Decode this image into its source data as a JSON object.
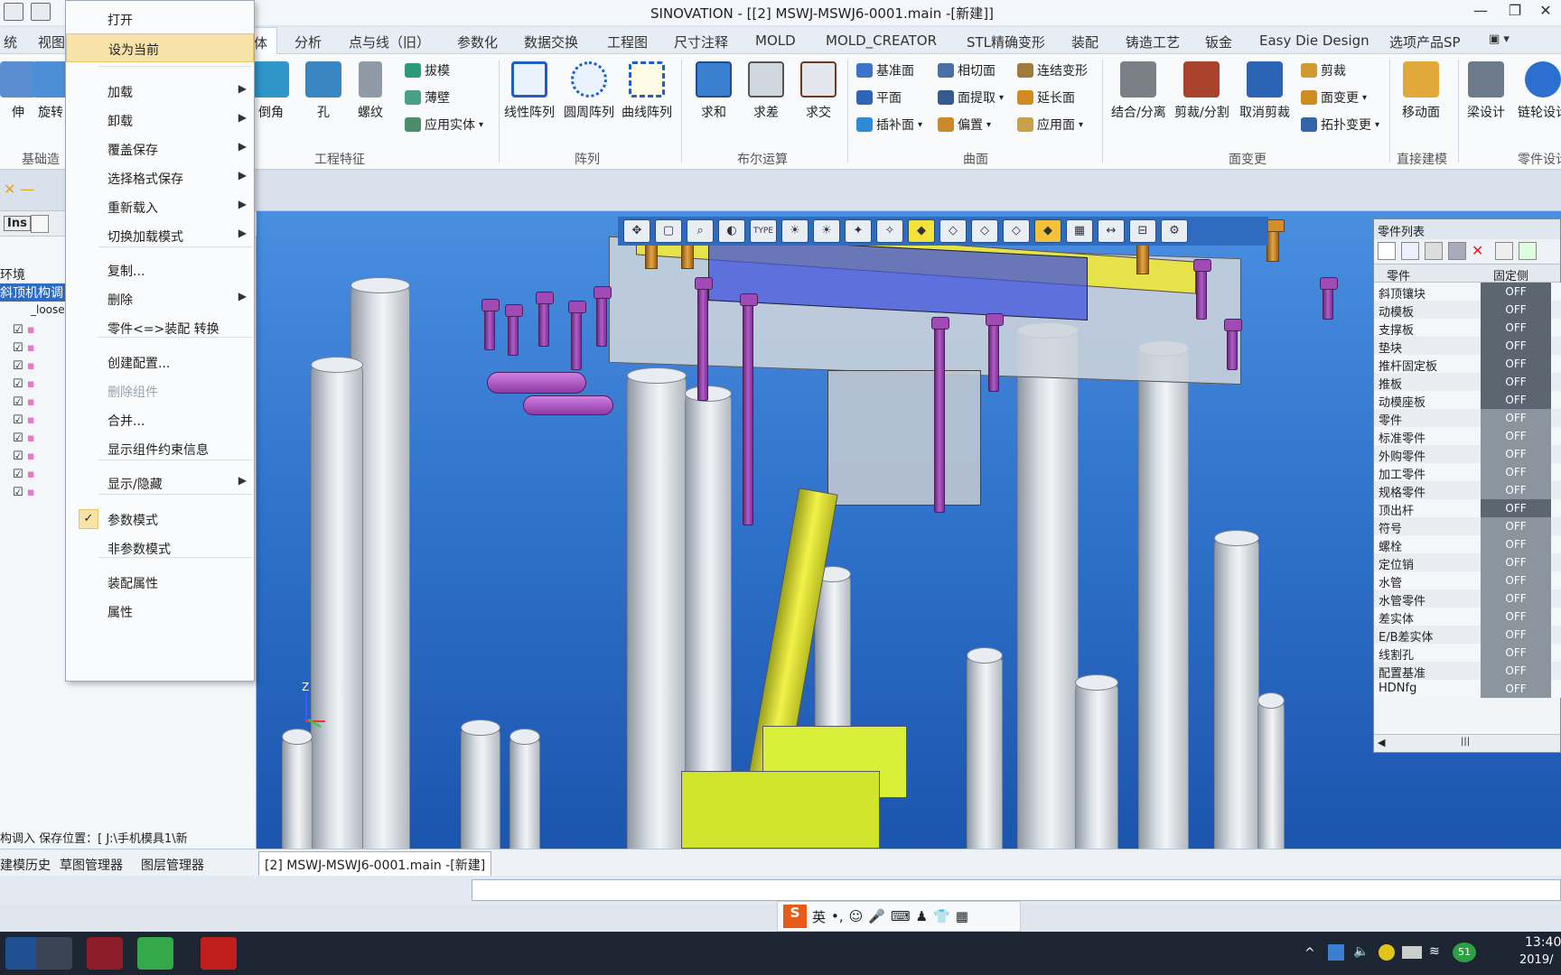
{
  "window": {
    "title": "SINOVATION - [[2] MSWJ-MSWJ6-0001.main -[新建]]",
    "minimize": "—",
    "maximize": "❐",
    "close": "✕"
  },
  "tabs": [
    "统",
    "视图",
    "体",
    "分析",
    "点与线（旧）",
    "参数化",
    "数据交换",
    "工程图",
    "尺寸注释",
    "MOLD",
    "MOLD_CREATOR",
    "STL精确变形",
    "装配",
    "铸造工艺",
    "钣金",
    "Easy Die Design",
    "选项产品SP"
  ],
  "active_tab": "体",
  "ribbon": {
    "partial_left": {
      "btn1": "伸",
      "btn2": "旋转",
      "group": "基础造"
    },
    "engineering": {
      "chamfer": "倒角",
      "hole": "孔",
      "thread": "螺纹",
      "draft": "拔模",
      "shell": "薄壁",
      "apply_solid": "应用实体",
      "group": "工程特征"
    },
    "array": {
      "linear": "线性阵列",
      "circular": "圆周阵列",
      "curve": "曲线阵列",
      "group": "阵列"
    },
    "boolean": {
      "union": "求和",
      "subtract": "求差",
      "intersect": "求交",
      "group": "布尔运算"
    },
    "surface": {
      "base_plane": "基准面",
      "plane": "平面",
      "patch": "插补面",
      "tangent": "相切面",
      "extract": "面提取",
      "offset": "偏置",
      "connect": "连结变形",
      "extend": "延长面",
      "apply_face": "应用面",
      "group": "曲面"
    },
    "face_change": {
      "combine": "结合/分离",
      "cut_split": "剪裁/分割",
      "uncut": "取消剪裁",
      "trim": "剪裁",
      "face_change": "面变更",
      "topo": "拓扑变更",
      "group": "面变更"
    },
    "direct": {
      "move_face": "移动面",
      "group": "直接建模"
    },
    "part_design": {
      "beam": "梁设计",
      "gear": "链轮设计",
      "group": "零件设计"
    }
  },
  "left_panel": {
    "header_ins": "Ins",
    "env_label": "环境",
    "selected_item": "斜顶机构调",
    "loose_item": "_loose",
    "status": "构调入  保存位置：[ J:\\手机模具1\\新",
    "bottom_tabs": [
      "建模历史",
      "草图管理器",
      "图层管理器"
    ]
  },
  "context_menu": {
    "items": [
      {
        "label": "打开",
        "arrow": false
      },
      {
        "label": "设为当前",
        "arrow": false,
        "highlighted": true
      },
      {
        "label": "加载",
        "arrow": true
      },
      {
        "label": "卸载",
        "arrow": true
      },
      {
        "label": "覆盖保存",
        "arrow": true
      },
      {
        "label": "选择格式保存",
        "arrow": true
      },
      {
        "label": "重新载入",
        "arrow": true
      },
      {
        "label": "切换加载模式",
        "arrow": true
      },
      {
        "label": "复制...",
        "arrow": false
      },
      {
        "label": "删除",
        "arrow": true
      },
      {
        "label": "零件<=>装配 转换",
        "arrow": false
      },
      {
        "label": "创建配置...",
        "arrow": false
      },
      {
        "label": "删除组件",
        "arrow": false,
        "disabled": true
      },
      {
        "label": "合并...",
        "arrow": false
      },
      {
        "label": "显示组件约束信息",
        "arrow": false
      },
      {
        "label": "显示/隐藏",
        "arrow": true
      },
      {
        "label": "参数模式",
        "arrow": false,
        "checked": true
      },
      {
        "label": "非参数模式",
        "arrow": false
      },
      {
        "label": "装配属性",
        "arrow": false
      },
      {
        "label": "属性",
        "arrow": false
      }
    ],
    "arrow_glyph": "▶",
    "check_glyph": "✓"
  },
  "viewport": {
    "toolbar_label": "TYPE",
    "axis_z": "Z",
    "tab_label": "[2] MSWJ-MSWJ6-0001.main -[新建]"
  },
  "part_list": {
    "title": "零件列表",
    "col_part": "零件",
    "col_fixed": "固定侧",
    "rows": [
      {
        "name": "斜顶镶块",
        "state": "OFF"
      },
      {
        "name": "动模板",
        "state": "OFF"
      },
      {
        "name": "支撑板",
        "state": "OFF"
      },
      {
        "name": "垫块",
        "state": "OFF"
      },
      {
        "name": "推杆固定板",
        "state": "OFF"
      },
      {
        "name": "推板",
        "state": "OFF"
      },
      {
        "name": "动模座板",
        "state": "OFF"
      },
      {
        "name": "零件",
        "state": "OFF"
      },
      {
        "name": "标准零件",
        "state": "OFF"
      },
      {
        "name": "外购零件",
        "state": "OFF"
      },
      {
        "name": "加工零件",
        "state": "OFF"
      },
      {
        "name": "规格零件",
        "state": "OFF"
      },
      {
        "name": "顶出杆",
        "state": "OFF"
      },
      {
        "name": "符号",
        "state": "OFF"
      },
      {
        "name": "螺栓",
        "state": "OFF"
      },
      {
        "name": "定位销",
        "state": "OFF"
      },
      {
        "name": "水管",
        "state": "OFF"
      },
      {
        "name": "水管零件",
        "state": "OFF"
      },
      {
        "name": "差实体",
        "state": "OFF"
      },
      {
        "name": "E/B差实体",
        "state": "OFF"
      },
      {
        "name": "线割孔",
        "state": "OFF"
      },
      {
        "name": "配置基准",
        "state": "OFF"
      },
      {
        "name": "HDNfg",
        "state": "OFF"
      }
    ]
  },
  "ime": {
    "lang": "英",
    "punct": "•,"
  },
  "taskbar": {
    "time": "13:40",
    "date": "2019/",
    "badge": "51"
  },
  "colors": {
    "accent": "#2f6bbf",
    "menu_highlight": "#f7e3a7",
    "part_off_dark": "#5d6570",
    "part_off_light": "#8c949e"
  }
}
